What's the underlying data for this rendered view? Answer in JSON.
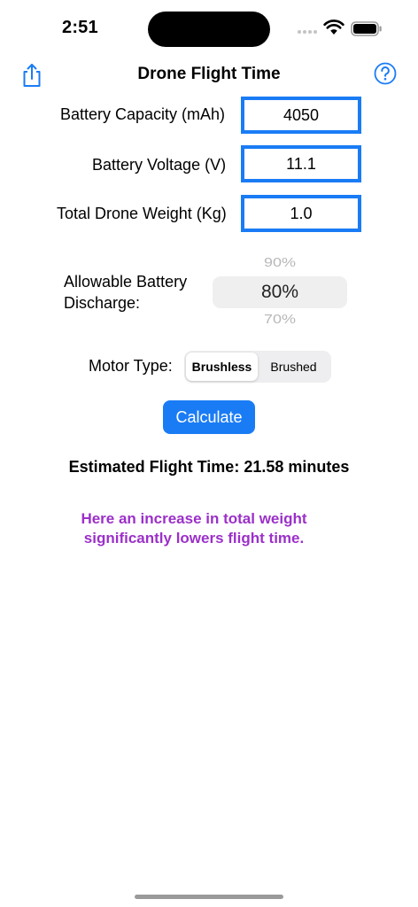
{
  "status_bar": {
    "time": "2:51"
  },
  "nav": {
    "title": "Drone Flight Time",
    "share_icon": "share-icon",
    "help_icon": "question-mark-circle-icon"
  },
  "form": {
    "battery_capacity": {
      "label": "Battery Capacity (mAh)",
      "value": "4050"
    },
    "battery_voltage": {
      "label": "Battery Voltage (V)",
      "value": "11.1"
    },
    "drone_weight": {
      "label": "Total Drone Weight (Kg)",
      "value": "1.0"
    }
  },
  "discharge": {
    "label": "Allowable Battery Discharge:",
    "option_above": "90%",
    "selected": "80%",
    "option_below": "70%"
  },
  "motor": {
    "label": "Motor Type:",
    "options": [
      "Brushless",
      "Brushed"
    ],
    "selected": "Brushless"
  },
  "calculate_label": "Calculate",
  "result": "Estimated Flight Time: 21.58 minutes",
  "note": "Here an increase in total weight significantly lowers flight time.",
  "colors": {
    "accent": "#1a7cf5",
    "note": "#9b30c9"
  }
}
